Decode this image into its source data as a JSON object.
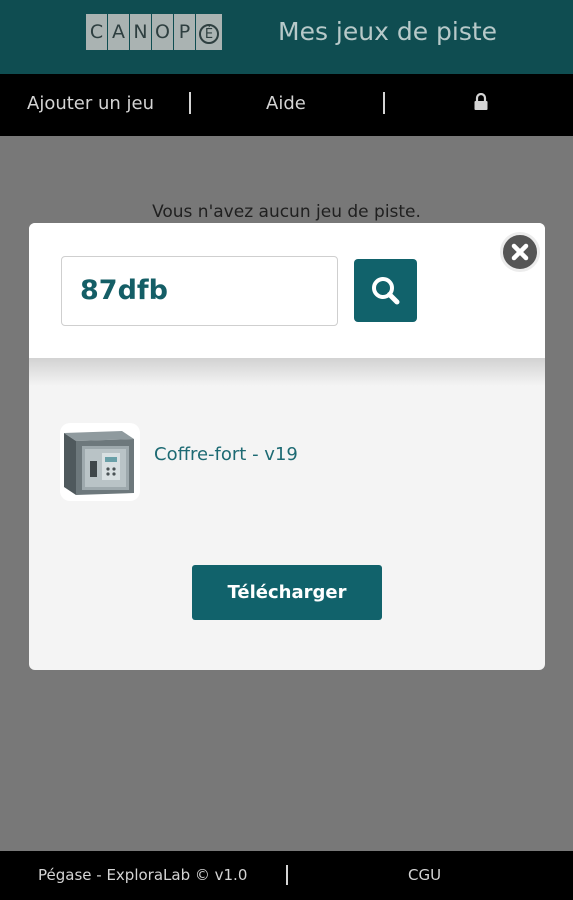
{
  "header": {
    "logo_letters": [
      "C",
      "A",
      "N",
      "O",
      "P",
      "É"
    ],
    "title": "Mes jeux de piste"
  },
  "nav": {
    "add_game": "Ajouter un jeu",
    "help": "Aide",
    "lock_icon": "lock-icon"
  },
  "main": {
    "empty_message": "Vous n'avez aucun jeu de piste."
  },
  "modal": {
    "search_value": "87dfb",
    "search_icon": "search-icon",
    "close_icon": "close-icon",
    "result": {
      "name": "Coffre-fort - v19",
      "thumbnail_icon": "safe-icon"
    },
    "download_label": "Télécharger"
  },
  "footer": {
    "credits": "Pégase - ExploraLab © v1.0",
    "terms": "CGU"
  },
  "colors": {
    "header_bg": "#0f4d51",
    "accent": "#11626b",
    "overlay": "#787878"
  }
}
